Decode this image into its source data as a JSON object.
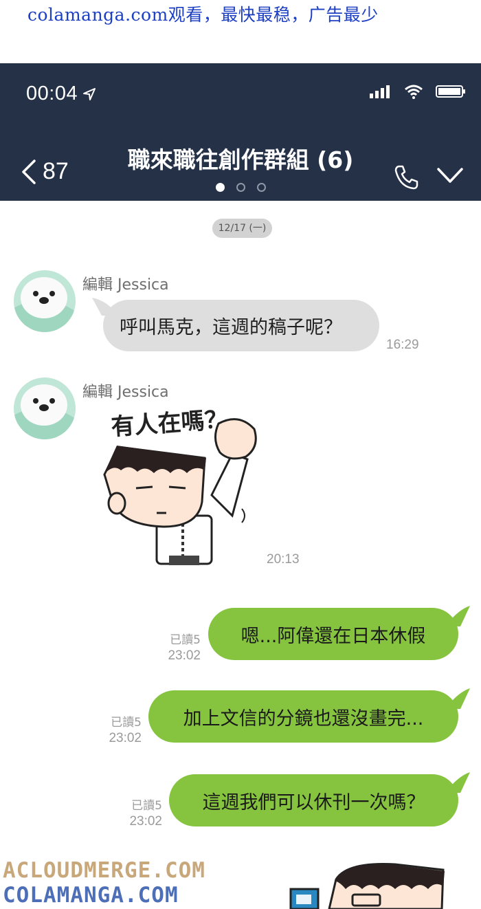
{
  "watermark_top": "colamanga.com观看，最快最稳，广告最少",
  "status_bar": {
    "time": "00:04",
    "location_icon": "location-arrow-icon",
    "signal_icon": "cell-signal-icon",
    "wifi_icon": "wifi-icon",
    "battery_icon": "battery-icon"
  },
  "header": {
    "back_count": "87",
    "title": "職來職往創作群組 (6)",
    "page_indicator_count": 3,
    "page_indicator_active": 0,
    "background": "#253147"
  },
  "date_separator": "12/17 (一)",
  "messages": [
    {
      "direction": "in",
      "sender": "編輯 Jessica",
      "text": "呼叫馬克，這週的稿子呢？",
      "time": "16:29"
    },
    {
      "direction": "in",
      "sender": "編輯 Jessica",
      "sticker_caption": "有人在嗎？",
      "time": "20:13"
    },
    {
      "direction": "out",
      "text": "嗯...阿偉還在日本休假",
      "read": "已讀5",
      "time": "23:02"
    },
    {
      "direction": "out",
      "text": "加上文信的分鏡也還沒畫完...",
      "read": "已讀5",
      "time": "23:02"
    },
    {
      "direction": "out",
      "text": "這週我們可以休刊一次嗎？",
      "read": "已讀5",
      "time": "23:02"
    }
  ],
  "colors": {
    "outgoing_bubble": "#86c440",
    "incoming_bubble": "#dedede"
  },
  "watermark_bottom": [
    "ACLOUDMERGE.COM",
    "COLAMANGA.COM"
  ]
}
